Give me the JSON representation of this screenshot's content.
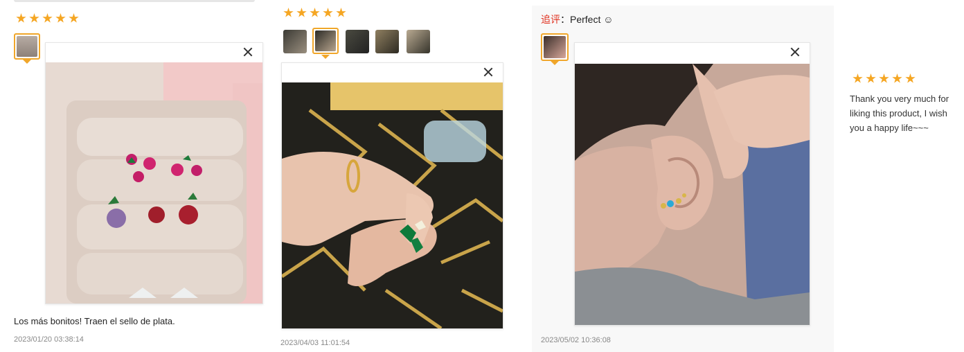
{
  "reviews": [
    {
      "rating": 5,
      "text": "Los más bonitos! Traen el sello de plata.",
      "date": "2023/01/20 03:38:14",
      "thumb_icon": "photo-thumbnail-icon"
    },
    {
      "rating": 5,
      "date": "2023/04/03 11:01:54",
      "thumb_count": 5,
      "selected_thumb": 2
    },
    {
      "followup_label": "追评",
      "followup_sep": "：",
      "followup_text": "Perfect ☺",
      "date": "2023/05/02 10:36:08"
    },
    {
      "rating": 5,
      "text": "Thank you very much for liking this product, I wish you a happy life~~~"
    }
  ],
  "icons": {
    "star": "star-icon",
    "close": "close-icon"
  },
  "colors": {
    "star": "#f5a623",
    "accent_border": "#f0a62a",
    "followup_label": "#e0301e"
  }
}
